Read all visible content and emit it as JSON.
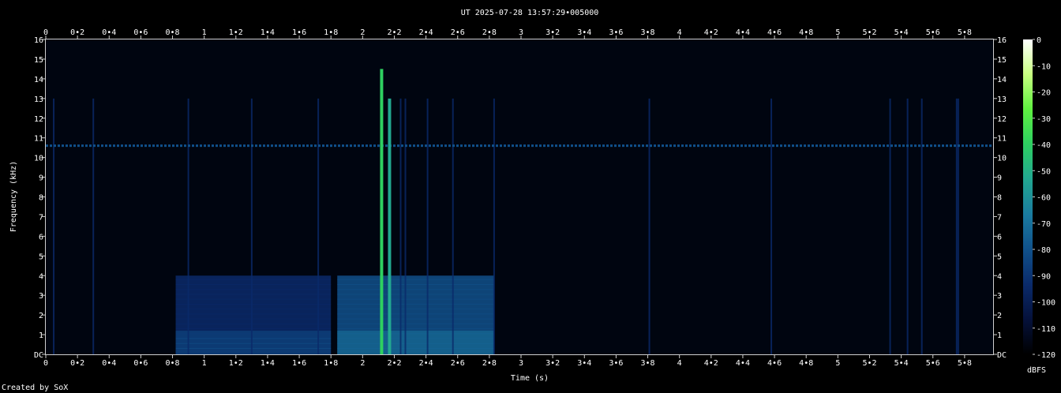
{
  "chart_data": {
    "type": "heatmap",
    "title": "UT 2025-07-28 13:57:29•005000",
    "xlabel": "Time (s)",
    "ylabel": "Frequency (kHz)",
    "colorbar_label": "dBFS",
    "credit": "Created by SoX",
    "xlim": [
      0,
      5.98
    ],
    "ylim": [
      0,
      16
    ],
    "clim": [
      -120,
      0
    ],
    "x_ticks": [
      "0",
      "0•2",
      "0•4",
      "0•6",
      "0•8",
      "1",
      "1•2",
      "1•4",
      "1•6",
      "1•8",
      "2",
      "2•2",
      "2•4",
      "2•6",
      "2•8",
      "3",
      "3•2",
      "3•4",
      "3•6",
      "3•8",
      "4",
      "4•2",
      "4•4",
      "4•6",
      "4•8",
      "5",
      "5•2",
      "5•4",
      "5•6",
      "5•8"
    ],
    "y_ticks": [
      "DC",
      "1",
      "2",
      "3",
      "4",
      "5",
      "6",
      "7",
      "8",
      "9",
      "10",
      "11",
      "12",
      "13",
      "14",
      "15",
      "16"
    ],
    "colorbar_ticks": [
      "0",
      "-10",
      "-20",
      "-30",
      "-40",
      "-50",
      "-60",
      "-70",
      "-80",
      "-90",
      "-100",
      "-110",
      "-120"
    ],
    "colormap": [
      "#000000",
      "#05113a",
      "#0a2a6a",
      "#10508a",
      "#1a7aa0",
      "#22a890",
      "#2ed060",
      "#60f040",
      "#c8ff80",
      "#ffffff"
    ],
    "features": {
      "tone_line": {
        "freq_khz": 10.6,
        "level_dbfs": -80
      },
      "broadband_bursts": [
        {
          "t_start": 0.82,
          "t_end": 1.8,
          "f_max_khz": 4.0,
          "level_dbfs": -95
        },
        {
          "t_start": 1.84,
          "t_end": 2.83,
          "f_max_khz": 4.0,
          "level_dbfs": -85
        }
      ],
      "strong_transients": [
        {
          "t": 2.12,
          "f_max_khz": 14.5,
          "level_dbfs": -40
        },
        {
          "t": 2.17,
          "f_max_khz": 13.0,
          "level_dbfs": -55
        }
      ],
      "weak_transients_s": [
        0.05,
        0.3,
        0.9,
        1.3,
        1.72,
        2.24,
        2.27,
        2.41,
        2.57,
        2.83,
        3.81,
        4.58,
        5.33,
        5.44,
        5.53,
        5.75,
        5.76
      ]
    }
  }
}
